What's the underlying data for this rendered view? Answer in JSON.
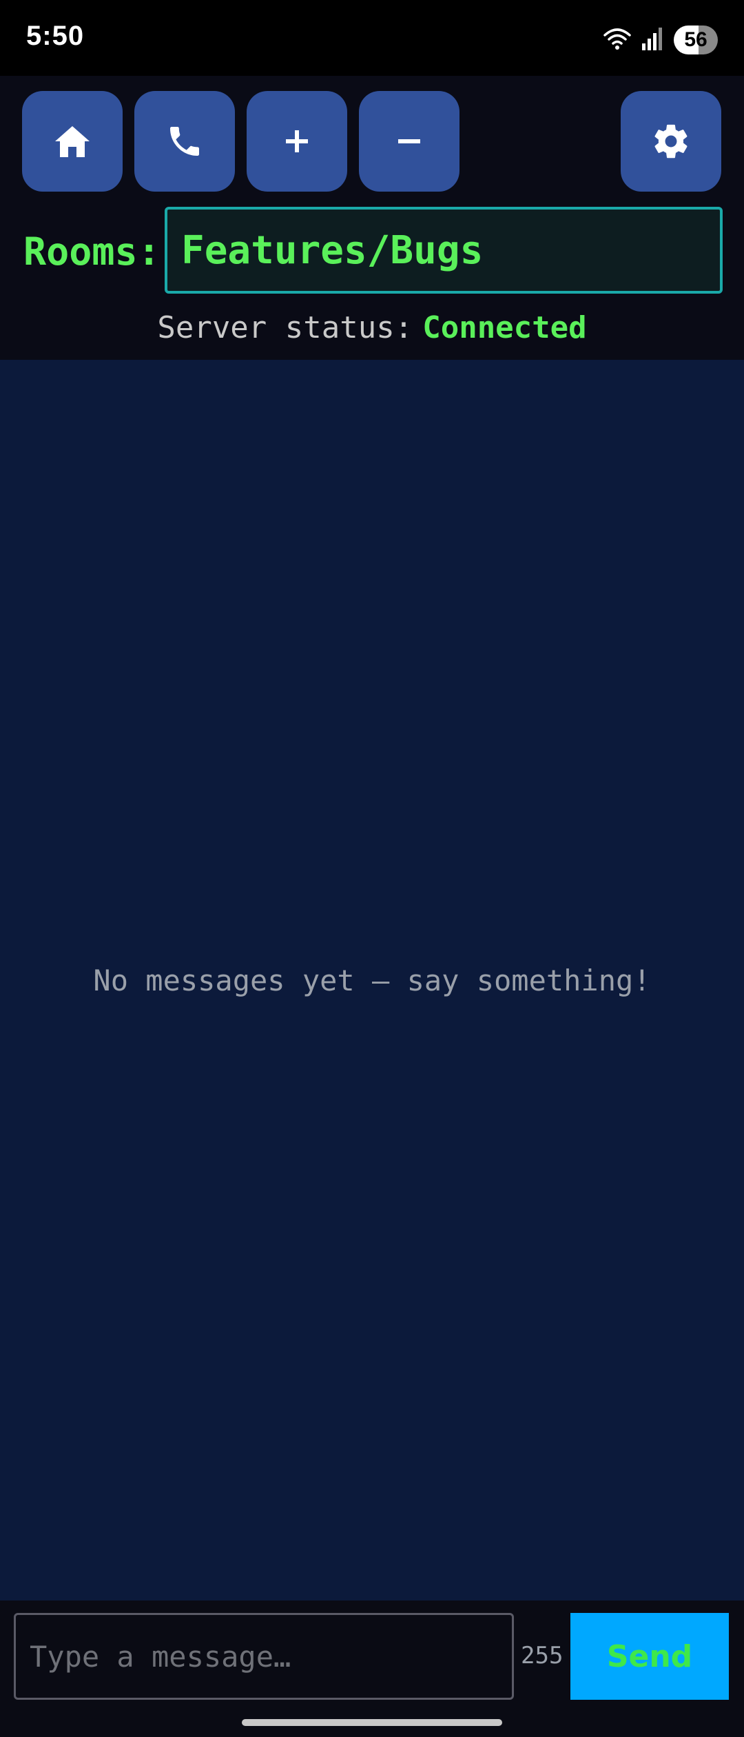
{
  "status_bar": {
    "time": "5:50",
    "battery": "56",
    "icons": [
      "wifi-icon",
      "signal-icon",
      "battery-icon"
    ]
  },
  "toolbar": {
    "buttons": [
      {
        "name": "home-button",
        "icon": "home-icon"
      },
      {
        "name": "call-button",
        "icon": "phone-icon"
      },
      {
        "name": "add-button",
        "icon": "plus-icon"
      },
      {
        "name": "remove-button",
        "icon": "minus-icon"
      },
      {
        "name": "settings-button",
        "icon": "gear-icon"
      }
    ]
  },
  "rooms": {
    "label": "Rooms:",
    "value": "Features/Bugs"
  },
  "server": {
    "label": "Server status:",
    "value": "Connected"
  },
  "messages": {
    "empty_text": "No messages yet — say something!"
  },
  "composer": {
    "placeholder": "Type a message…",
    "char_count": "255",
    "send_label": "Send"
  },
  "colors": {
    "accent_green": "#5af05a",
    "button_blue": "#31519b",
    "send_blue": "#00a8ff",
    "messages_bg": "#0c1a3b",
    "input_border": "#1aa9a9"
  }
}
